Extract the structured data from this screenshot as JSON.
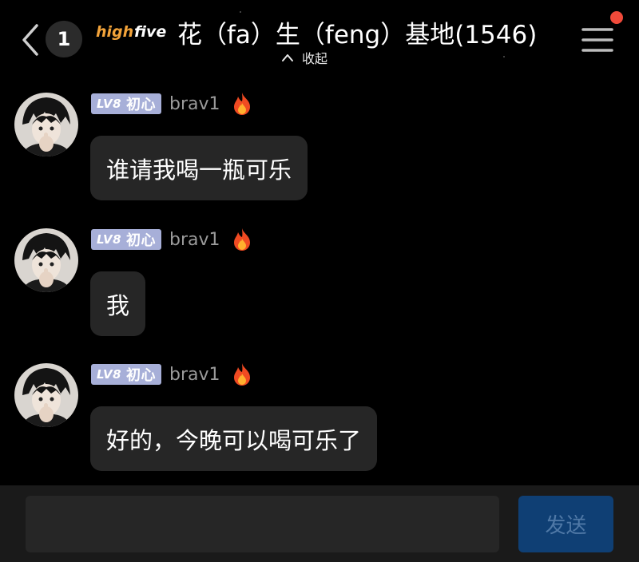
{
  "header": {
    "unread_count": "1",
    "logo_text": "high five",
    "title": "花（fa）生（feng）基地(1546)",
    "collapse_label": "收起"
  },
  "messages": [
    {
      "level": "LV8",
      "level_name": "初心",
      "username": "brav1",
      "text": "谁请我喝一瓶可乐"
    },
    {
      "level": "LV8",
      "level_name": "初心",
      "username": "brav1",
      "text": "我"
    },
    {
      "level": "LV8",
      "level_name": "初心",
      "username": "brav1",
      "text": "好的，今晚可以喝可乐了"
    }
  ],
  "composer": {
    "input_value": "",
    "send_label": "发送"
  },
  "colors": {
    "background": "#000000",
    "bubble": "#262626",
    "level_badge": "#a7afd8",
    "send_button": "#0f3f74",
    "notify_dot": "#f04a3a"
  },
  "icons": {
    "back": "chevron-left-icon",
    "menu": "hamburger-menu-icon",
    "collapse": "chevron-up-icon",
    "fire": "fire-icon"
  }
}
